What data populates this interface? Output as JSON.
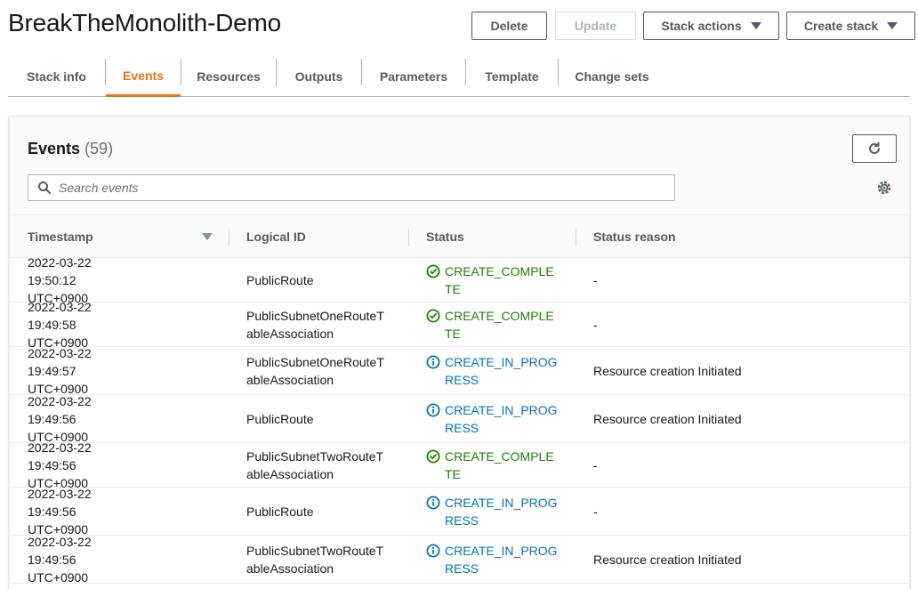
{
  "page": {
    "title": "BreakTheMonolith-Demo"
  },
  "actions": {
    "delete": "Delete",
    "update": "Update",
    "stack_actions": "Stack actions",
    "create_stack": "Create stack"
  },
  "tabs": [
    {
      "label": "Stack info"
    },
    {
      "label": "Events"
    },
    {
      "label": "Resources"
    },
    {
      "label": "Outputs"
    },
    {
      "label": "Parameters"
    },
    {
      "label": "Template"
    },
    {
      "label": "Change sets"
    }
  ],
  "active_tab": "Events",
  "events": {
    "title": "Events",
    "count": "(59)",
    "search_placeholder": "Search events",
    "columns": {
      "timestamp": "Timestamp",
      "logical_id": "Logical ID",
      "status": "Status",
      "status_reason": "Status reason"
    },
    "rows": [
      {
        "timestamp": "2022-03-22 19:50:12 UTC+0900",
        "logical_id": "PublicRoute",
        "status": "CREATE_COMPLETE",
        "reason": "-"
      },
      {
        "timestamp": "2022-03-22 19:49:58 UTC+0900",
        "logical_id": "PublicSubnetOneRouteTableAssociation",
        "status": "CREATE_COMPLETE",
        "reason": "-"
      },
      {
        "timestamp": "2022-03-22 19:49:57 UTC+0900",
        "logical_id": "PublicSubnetOneRouteTableAssociation",
        "status": "CREATE_IN_PROGRESS",
        "reason": "Resource creation Initiated"
      },
      {
        "timestamp": "2022-03-22 19:49:56 UTC+0900",
        "logical_id": "PublicRoute",
        "status": "CREATE_IN_PROGRESS",
        "reason": "Resource creation Initiated"
      },
      {
        "timestamp": "2022-03-22 19:49:56 UTC+0900",
        "logical_id": "PublicSubnetTwoRouteTableAssociation",
        "status": "CREATE_COMPLETE",
        "reason": "-"
      },
      {
        "timestamp": "2022-03-22 19:49:56 UTC+0900",
        "logical_id": "PublicRoute",
        "status": "CREATE_IN_PROGRESS",
        "reason": "-"
      },
      {
        "timestamp": "2022-03-22 19:49:56 UTC+0900",
        "logical_id": "PublicSubnetTwoRouteTableAssociation",
        "status": "CREATE_IN_PROGRESS",
        "reason": "Resource creation Initiated"
      }
    ]
  },
  "icons": {
    "complete": "check-circle-icon",
    "in_progress": "info-circle-icon",
    "refresh": "refresh-icon",
    "settings": "gear-icon",
    "search": "search-icon"
  },
  "colors": {
    "accent": "#ec7211",
    "success": "#1d8102",
    "info": "#0073bb"
  }
}
